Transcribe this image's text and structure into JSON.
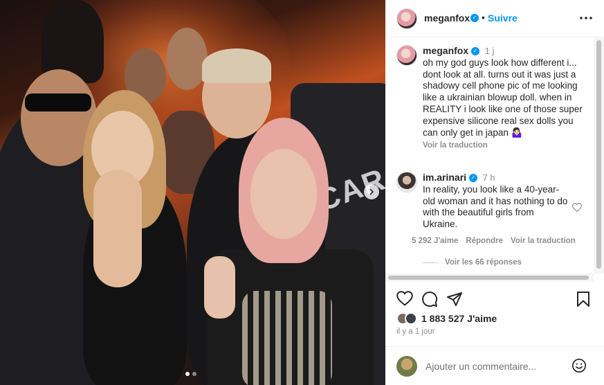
{
  "post": {
    "author": "meganfox",
    "follow_label": "Suivre",
    "separator": "•",
    "media_text": "CAR"
  },
  "comments": [
    {
      "username": "meganfox",
      "time": "1 j",
      "text": "oh my god guys look how different i... dont look at all. turns out it was just a shadowy cell phone pic of me looking like a ukrainian blowup doll. when in REALITY i look like one of those super expensive silicone real sex dolls you can only get in japan 🤷🏻‍♀️",
      "translate_label": "Voir la traduction"
    },
    {
      "username": "im.arinari",
      "time": "7 h",
      "text": "In reality, you look like a 40-year-old woman and it has nothing to do with the beautiful girls from Ukraine.",
      "likes_label": "5 292 J'aime",
      "reply_label": "Répondre",
      "translate_label": "Voir la traduction",
      "replies_label": "Voir les 66 réponses"
    }
  ],
  "footer": {
    "likes": "1 883 527 J'aime",
    "date": "il y a 1 jour",
    "comment_placeholder": "Ajouter un commentaire..."
  },
  "icons": {
    "like": "heart-icon",
    "comment": "comment-bubble-icon",
    "share": "paper-plane-icon",
    "save": "bookmark-icon",
    "more": "more-horizontal-icon",
    "emoji": "smiley-icon",
    "next": "chevron-right-icon"
  },
  "colors": {
    "accent": "#0095f6",
    "muted": "#8e8e8e",
    "text": "#262626"
  },
  "carousel": {
    "total": 2,
    "current": 1
  }
}
